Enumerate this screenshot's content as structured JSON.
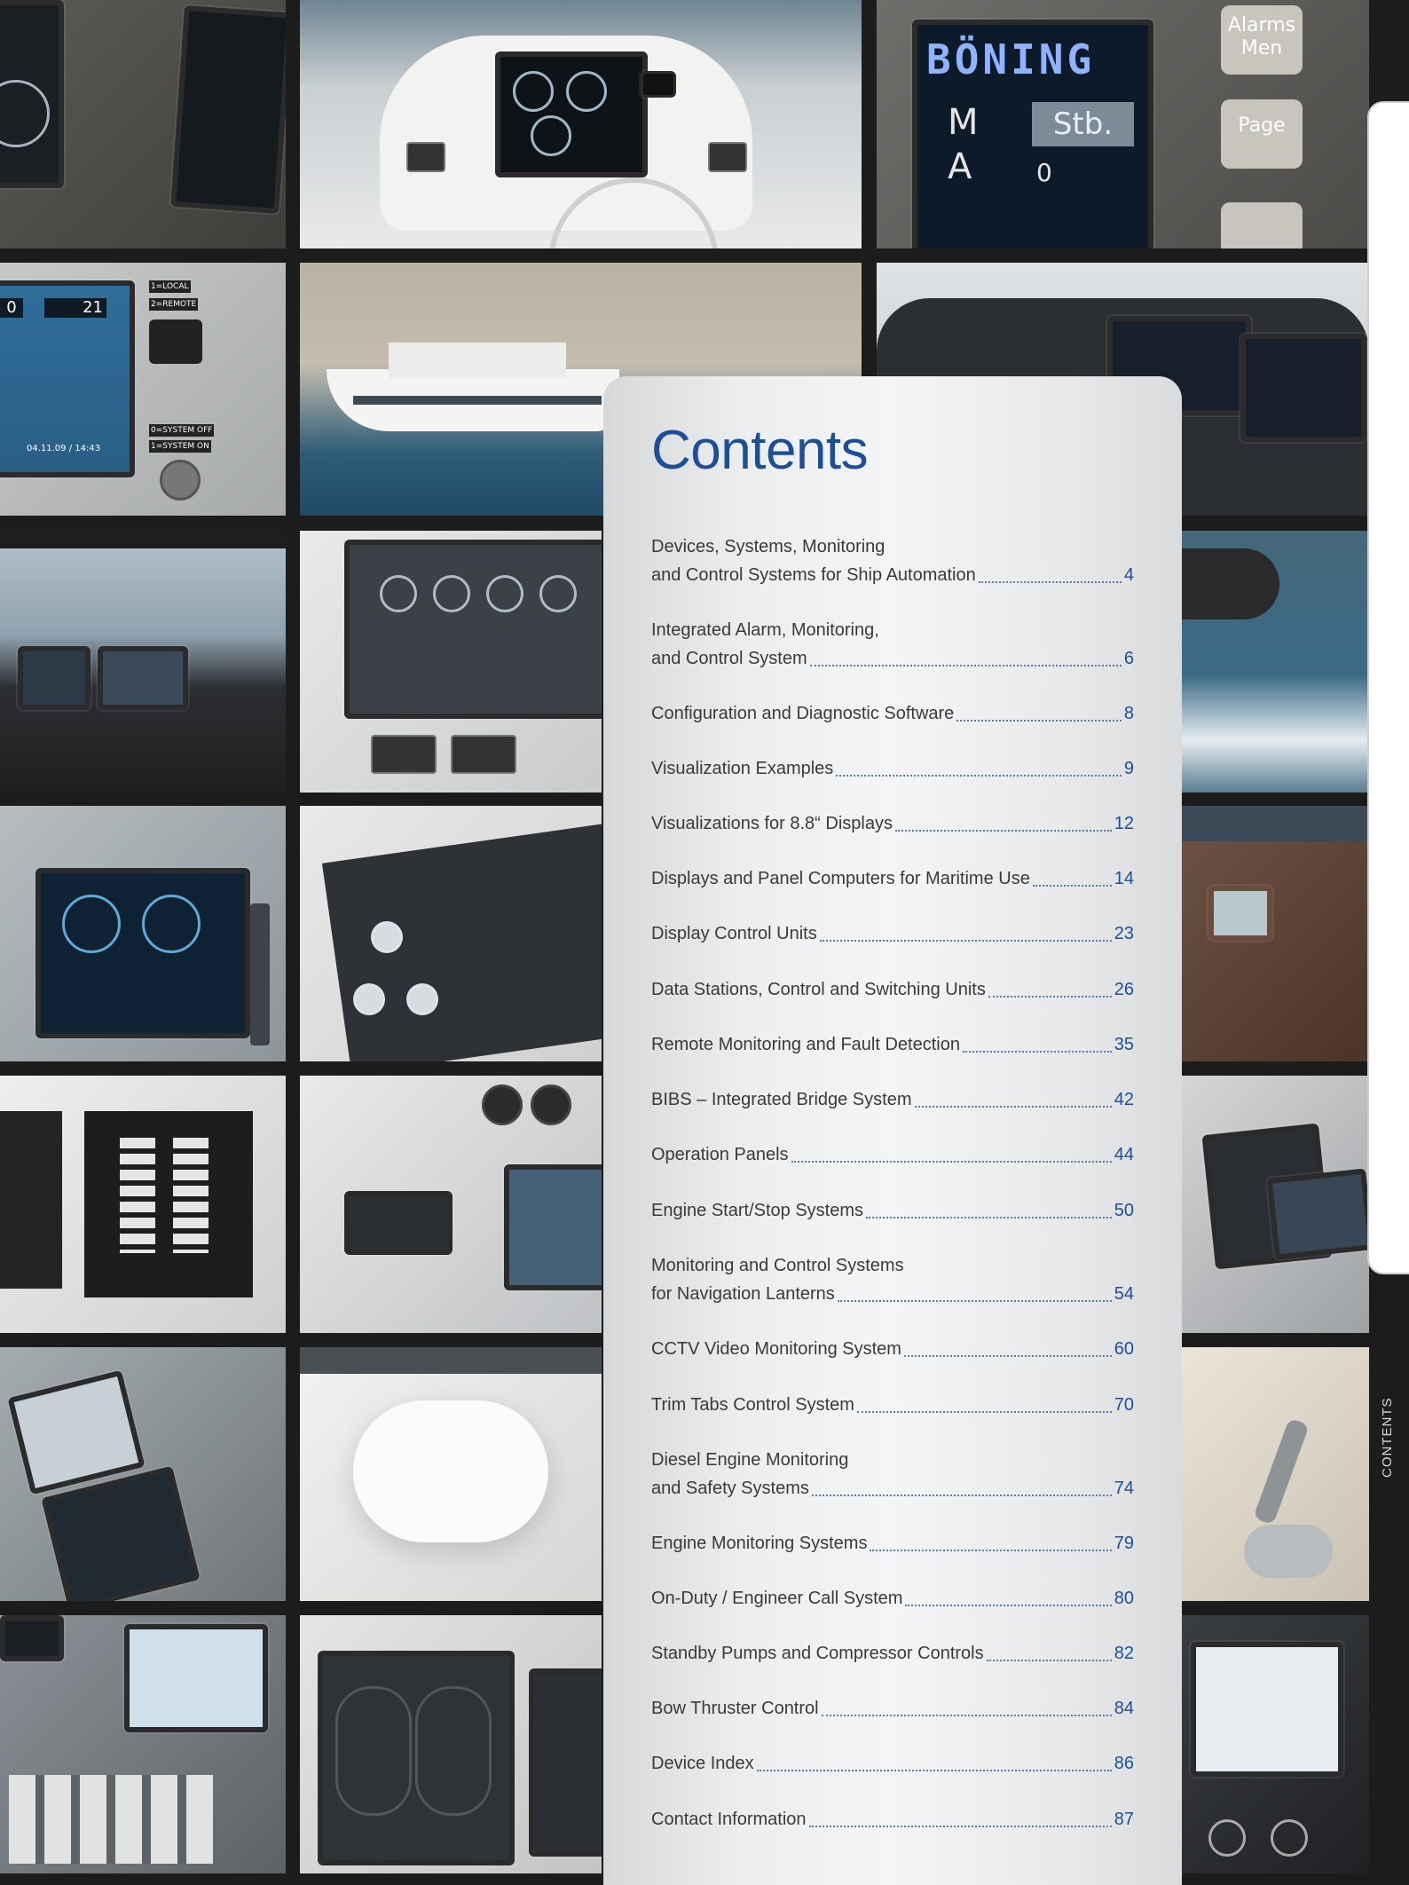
{
  "page": {
    "title": "Contents",
    "side_label": "CONTENTS"
  },
  "colors": {
    "accent": "#1d4f99",
    "text": "#3a3a3a",
    "panel": "#eceeef",
    "gutter": "#1c1c1c"
  },
  "photo_text": {
    "brand_screen": "BÖNING",
    "alarms_button": "Alarms\nMen",
    "page_button": "Page",
    "stb_label": "Stb.",
    "m_label": "M",
    "a_label": "A",
    "value_left": "0",
    "value_right": "21",
    "local_label": "1=LOCAL",
    "remote_label": "2=REMOTE",
    "system_off": "0=SYSTEM OFF",
    "system_on": "1=SYSTEM ON",
    "datetime": "04.11.09 / 14:43"
  },
  "toc": [
    {
      "lines": [
        "Devices, Systems, Monitoring"
      ],
      "last": "and Control Systems for Ship Automation",
      "page": "4"
    },
    {
      "lines": [
        "Integrated Alarm, Monitoring,"
      ],
      "last": "and Control System",
      "page": "6"
    },
    {
      "lines": [],
      "last": "Configuration and Diagnostic Software",
      "page": "8"
    },
    {
      "lines": [],
      "last": "Visualization Examples",
      "page": "9"
    },
    {
      "lines": [],
      "last": "Visualizations for 8.8“ Displays",
      "page": "12"
    },
    {
      "lines": [],
      "last": "Displays and Panel Computers for Maritime Use",
      "page": "14"
    },
    {
      "lines": [],
      "last": "Display Control Units",
      "page": "23"
    },
    {
      "lines": [],
      "last": "Data Stations, Control and Switching Units",
      "page": "26"
    },
    {
      "lines": [],
      "last": "Remote Monitoring and Fault Detection",
      "page": "35"
    },
    {
      "lines": [],
      "last": "BIBS – Integrated Bridge System",
      "page": "42"
    },
    {
      "lines": [],
      "last": "Operation Panels",
      "page": "44"
    },
    {
      "lines": [],
      "last": "Engine Start/Stop Systems",
      "page": "50"
    },
    {
      "lines": [
        "Monitoring and Control Systems"
      ],
      "last": "for Navigation Lanterns",
      "page": "54"
    },
    {
      "lines": [],
      "last": "CCTV Video Monitoring System",
      "page": "60"
    },
    {
      "lines": [],
      "last": "Trim Tabs Control System",
      "page": "70"
    },
    {
      "lines": [
        "Diesel Engine Monitoring"
      ],
      "last": "and Safety Systems",
      "page": "74"
    },
    {
      "lines": [],
      "last": "Engine Monitoring Systems",
      "page": "79"
    },
    {
      "lines": [],
      "last": "On-Duty / Engineer Call System",
      "page": "80"
    },
    {
      "lines": [],
      "last": "Standby Pumps and Compressor Controls",
      "page": "82"
    },
    {
      "lines": [],
      "last": "Bow Thruster Control",
      "page": "84"
    },
    {
      "lines": [],
      "last": "Device Index",
      "page": "86"
    },
    {
      "lines": [],
      "last": "Contact Information",
      "page": "87"
    }
  ]
}
